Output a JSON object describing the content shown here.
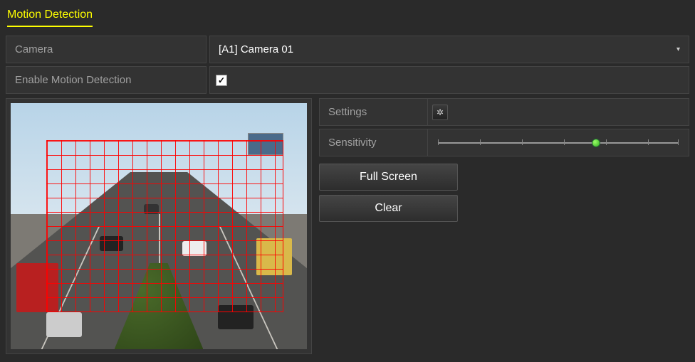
{
  "tab": {
    "title": "Motion Detection"
  },
  "form": {
    "camera_label": "Camera",
    "camera_value": "[A1] Camera 01",
    "enable_label": "Enable Motion Detection",
    "enable_checked": true
  },
  "settings": {
    "label": "Settings",
    "icon": "gear-icon"
  },
  "sensitivity": {
    "label": "Sensitivity",
    "value": 4,
    "min": 0,
    "max": 6,
    "thumb_percent": 65
  },
  "buttons": {
    "full_screen": "Full Screen",
    "clear": "Clear"
  },
  "preview": {
    "description": "highway-camera-view",
    "grid_active": true
  }
}
